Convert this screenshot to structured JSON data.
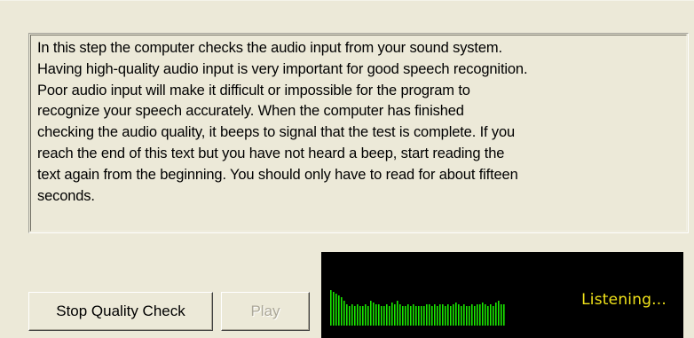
{
  "panel": {
    "lines": [
      "In this step the computer checks the audio input from your sound system.",
      "Having high-quality audio input is very important for good speech recognition.",
      "Poor audio input will make it difficult or impossible for the program to",
      "recognize your speech accurately. When the computer has finished",
      "checking the audio quality, it beeps to signal that the test is complete. If you",
      "reach the end of this text but you have not heard a beep, start reading the",
      "text again from the beginning. You should only have to read for about fifteen",
      "seconds."
    ]
  },
  "buttons": {
    "stop_label": "Stop Quality Check",
    "play_label": "Play",
    "play_enabled": false
  },
  "meter": {
    "status_text": "Listening...",
    "bar_color": "#19e600",
    "background": "#000000",
    "status_color": "#f0e21a",
    "levels": [
      1.0,
      0.95,
      0.9,
      0.85,
      0.8,
      0.7,
      0.6,
      0.55,
      0.6,
      0.55,
      0.6,
      0.55,
      0.55,
      0.6,
      0.55,
      0.7,
      0.65,
      0.6,
      0.6,
      0.55,
      0.55,
      0.6,
      0.55,
      0.65,
      0.6,
      0.7,
      0.6,
      0.55,
      0.55,
      0.6,
      0.55,
      0.6,
      0.55,
      0.55,
      0.55,
      0.55,
      0.6,
      0.6,
      0.55,
      0.6,
      0.55,
      0.6,
      0.6,
      0.55,
      0.6,
      0.55,
      0.6,
      0.65,
      0.6,
      0.55,
      0.6,
      0.55,
      0.55,
      0.6,
      0.55,
      0.6,
      0.6,
      0.65,
      0.6,
      0.55,
      0.6,
      0.55,
      0.65,
      0.7,
      0.6,
      0.6
    ]
  }
}
